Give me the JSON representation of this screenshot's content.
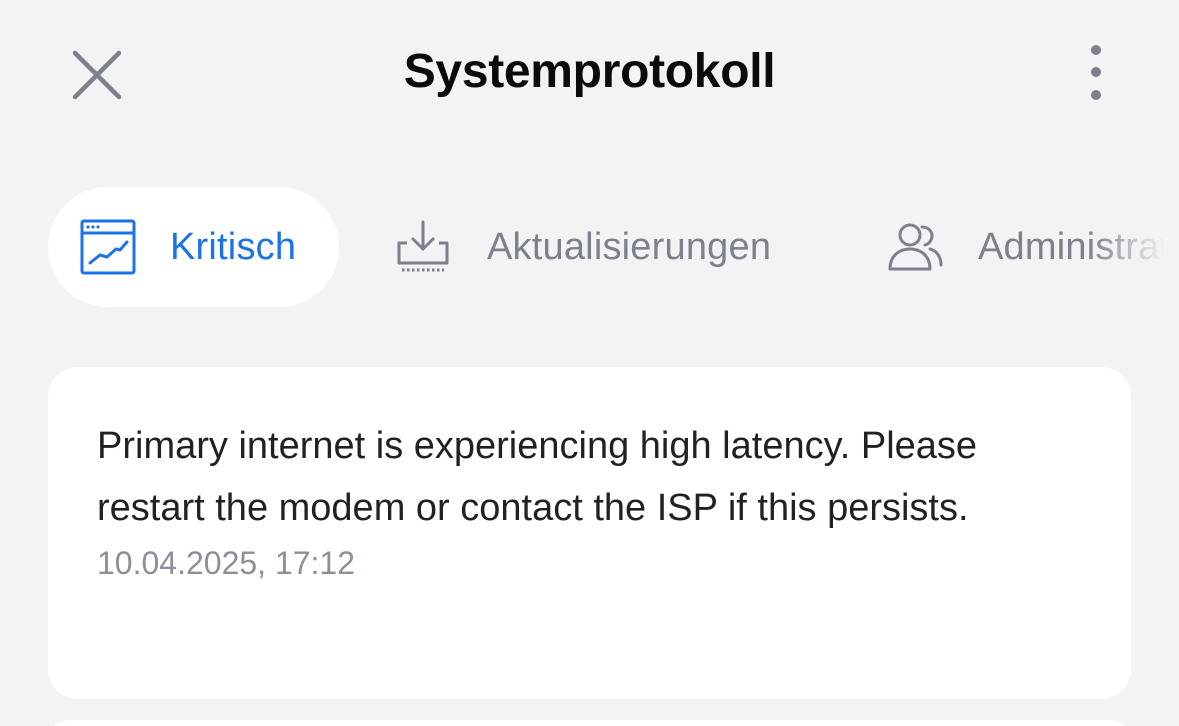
{
  "header": {
    "title": "Systemprotokoll",
    "close_icon": "close-icon",
    "more_icon": "more-vertical-icon"
  },
  "tabs": [
    {
      "label": "Kritisch",
      "icon": "chart-window-icon",
      "active": true
    },
    {
      "label": "Aktualisierungen",
      "icon": "download-tray-icon",
      "active": false
    },
    {
      "label": "Administrator",
      "icon": "users-icon",
      "active": false
    }
  ],
  "log_entries": [
    {
      "message": "Primary internet is experiencing high latency. Please restart the modem or contact the ISP if this persists.",
      "timestamp": "10.04.2025, 17:12"
    }
  ],
  "colors": {
    "background": "#f2f3f5",
    "accent": "#1a73e8",
    "inactive": "#7b828c",
    "card": "#ffffff"
  }
}
